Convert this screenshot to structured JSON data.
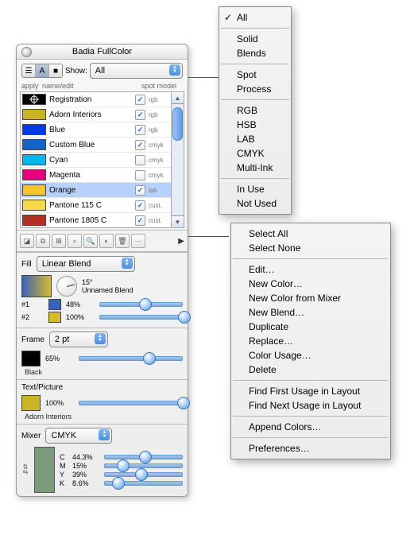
{
  "palette_title": "Badia FullColor",
  "show": {
    "label": "Show:",
    "value": "All"
  },
  "header": {
    "apply": "apply",
    "name": "name/edit",
    "spot": "spot model"
  },
  "colors": [
    {
      "name": "Registration",
      "swatch": "#000",
      "spot": true,
      "model": "rgb",
      "reg": true
    },
    {
      "name": "Adorn Interiors",
      "swatch": "#c9b423",
      "spot": true,
      "model": "rgb"
    },
    {
      "name": "Blue",
      "swatch": "#0039e6",
      "spot": true,
      "model": "rgb"
    },
    {
      "name": "Custom Blue",
      "swatch": "#1463c9",
      "spot": true,
      "model": "cmyk"
    },
    {
      "name": "Cyan",
      "swatch": "#00b6ef",
      "spot": false,
      "model": "cmyk"
    },
    {
      "name": "Magenta",
      "swatch": "#e6007e",
      "spot": false,
      "model": "cmyk"
    },
    {
      "name": "Orange",
      "swatch": "#f7c431",
      "spot": true,
      "model": "lab",
      "sel": true
    },
    {
      "name": "Pantone 115 C",
      "swatch": "#f9d949",
      "spot": true,
      "model": "cust."
    },
    {
      "name": "Pantone 1805 C",
      "swatch": "#b42f23",
      "spot": true,
      "model": "cust."
    }
  ],
  "tool_icons": [
    "new-color-icon",
    "duplicate-icon",
    "append-icon",
    "search-usage-icon",
    "zoom-icon",
    "globe-icon",
    "trash-icon",
    "more-icon"
  ],
  "fill": {
    "label": "Fill",
    "type": "Linear Blend",
    "angle": "15°",
    "name": "Unnamed Blend",
    "stops": [
      {
        "tag": "#1",
        "swatch": "#3a62b8",
        "pct": "48%",
        "pos": 48
      },
      {
        "tag": "#2",
        "swatch": "#d6bb2e",
        "pct": "100%",
        "pos": 95
      }
    ]
  },
  "frame": {
    "label": "Frame",
    "weight": "2 pt",
    "pct": "65%",
    "swatch": "#000",
    "name": "Black",
    "pos": 62
  },
  "textpic": {
    "label": "Text/Picture",
    "pct": "100%",
    "swatch": "#c9b423",
    "name": "Adorn Interiors",
    "pos": 95
  },
  "mixer": {
    "label": "Mixer",
    "model": "CMYK",
    "swatch": "#7e9a7d",
    "ch": [
      {
        "n": "C",
        "v": "44.3%",
        "p": 44
      },
      {
        "n": "M",
        "v": "15%",
        "p": 15
      },
      {
        "n": "Y",
        "v": "39%",
        "p": 39
      },
      {
        "n": "K",
        "v": "8.6%",
        "p": 9
      }
    ]
  },
  "show_menu": {
    "items": [
      [
        "All",
        "chk"
      ],
      "-",
      [
        "Solid"
      ],
      [
        "Blends"
      ],
      "-",
      [
        "Spot"
      ],
      [
        "Process"
      ],
      "-",
      [
        "RGB"
      ],
      [
        "HSB"
      ],
      [
        "LAB"
      ],
      [
        "CMYK"
      ],
      [
        "Multi-Ink"
      ],
      "-",
      [
        "In Use"
      ],
      [
        "Not Used"
      ]
    ]
  },
  "action_menu": {
    "items": [
      [
        "Select All"
      ],
      [
        "Select None"
      ],
      "-",
      [
        "Edit…"
      ],
      [
        "New Color…"
      ],
      [
        "New Color from Mixer"
      ],
      [
        "New Blend…"
      ],
      [
        "Duplicate"
      ],
      [
        "Replace…"
      ],
      [
        "Color Usage…"
      ],
      [
        "Delete"
      ],
      "-",
      [
        "Find First Usage in Layout"
      ],
      [
        "Find Next Usage in Layout"
      ],
      "-",
      [
        "Append Colors…"
      ],
      "-",
      [
        "Preferences…"
      ]
    ]
  }
}
